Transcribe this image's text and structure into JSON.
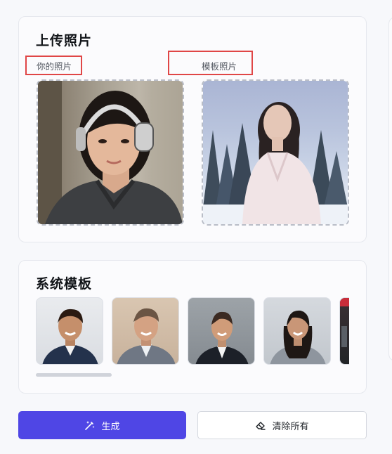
{
  "upload": {
    "title": "上传照片",
    "your_photo_label": "你的照片",
    "template_photo_label": "模板照片"
  },
  "system_templates": {
    "title": "系统模板"
  },
  "actions": {
    "generate_label": "生成",
    "clear_label": "清除所有"
  },
  "icons": {
    "generate": "magic-wand-icon",
    "clear": "eraser-icon"
  },
  "colors": {
    "accent": "#4f46e5",
    "highlight_border": "#e04646"
  }
}
